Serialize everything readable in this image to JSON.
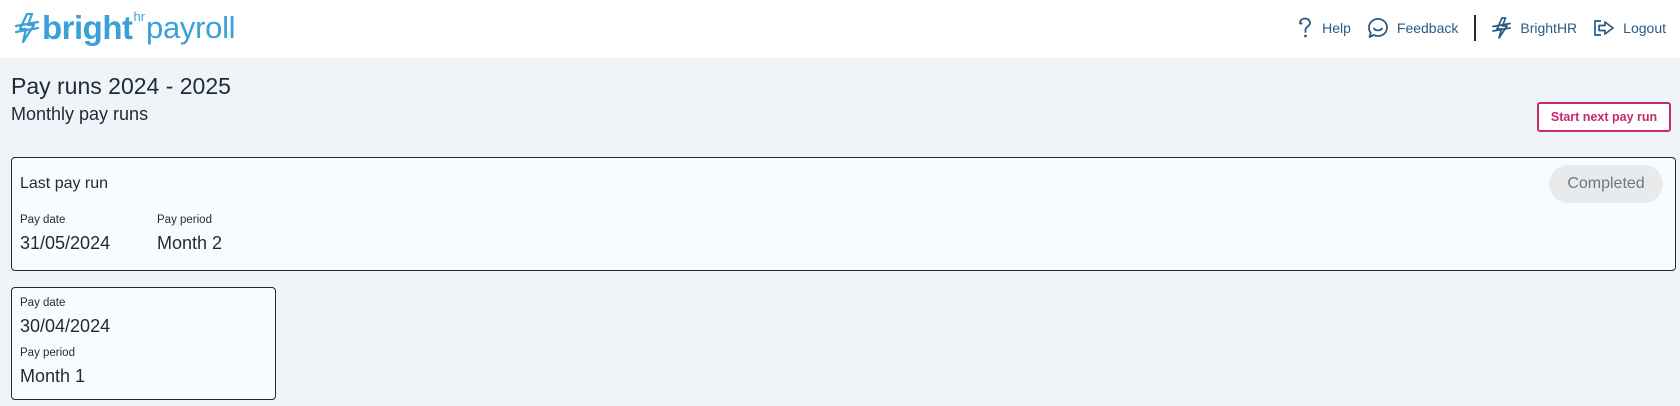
{
  "header": {
    "logo": {
      "icon": "brighthr-bolt-icon",
      "bright": "bright",
      "hr": "hr",
      "payroll": "payroll",
      "color": "#3aa1d8"
    },
    "nav": {
      "help": "Help",
      "feedback": "Feedback",
      "brighthr": "BrightHR",
      "logout": "Logout"
    }
  },
  "main": {
    "title": "Pay runs 2024 - 2025",
    "subtitle": "Monthly pay runs",
    "start_button": "Start next pay run"
  },
  "last_pay_run": {
    "title": "Last pay run",
    "status": "Completed",
    "pay_date_label": "Pay date",
    "pay_date": "31/05/2024",
    "pay_period_label": "Pay period",
    "pay_period": "Month 2"
  },
  "previous_pay_runs": [
    {
      "pay_date_label": "Pay date",
      "pay_date": "30/04/2024",
      "pay_period_label": "Pay period",
      "pay_period": "Month 1"
    }
  ],
  "colors": {
    "accent": "#c8286e",
    "brand": "#3aa1d8",
    "nav_text": "#2a5b85",
    "page_bg": "#eef4f8"
  }
}
